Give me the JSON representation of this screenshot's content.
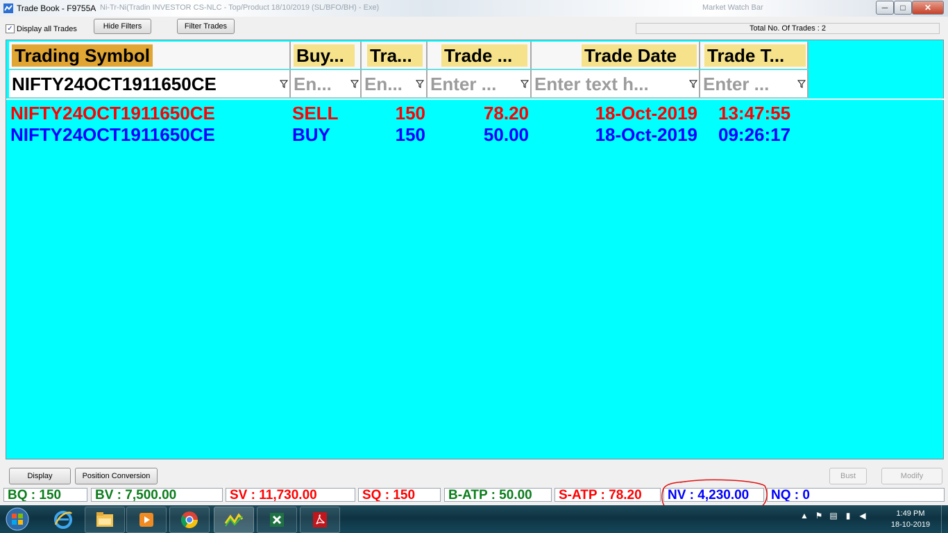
{
  "window": {
    "title": "Trade Book - F9755A",
    "background_title_text": "Ni-Tr-Ni(Tradin INVESTOR CS-NLC - Top/Product 18/10/2019 (SL/BFO/BH) - Exe)",
    "background_title_text2": "Market Watch Bar",
    "minimize_glyph": "─",
    "maximize_glyph": "□",
    "close_glyph": "✕"
  },
  "toolbar": {
    "display_all_label": "Display all Trades",
    "display_all_checked": true,
    "check_glyph": "✓",
    "hide_filters_label": "Hide Filters",
    "filter_trades_label": "Filter Trades",
    "total_trades_text": "Total No. Of Trades : 2"
  },
  "grid": {
    "columns": [
      {
        "header": "Trading Symbol",
        "filter": "NIFTY24OCT1911650CE",
        "filter_active": true,
        "sorted": true
      },
      {
        "header": "Buy...",
        "filter": "En...",
        "filter_active": false,
        "sorted": false
      },
      {
        "header": "Tra...",
        "filter": "En...",
        "filter_active": false,
        "sorted": false
      },
      {
        "header": "Trade ...",
        "filter": "Enter ...",
        "filter_active": false,
        "sorted": false
      },
      {
        "header": "Trade Date",
        "filter": "Enter text h...",
        "filter_active": false,
        "sorted": false
      },
      {
        "header": "Trade T...",
        "filter": "Enter ...",
        "filter_active": false,
        "sorted": false
      }
    ],
    "rows": [
      {
        "symbol": "NIFTY24OCT1911650CE",
        "side": "SELL",
        "qty": "150",
        "price": "78.20",
        "date": "18-Oct-2019",
        "time": "13:47:55",
        "color": "#ff0000"
      },
      {
        "symbol": "NIFTY24OCT1911650CE",
        "side": "BUY",
        "qty": "150",
        "price": "50.00",
        "date": "18-Oct-2019",
        "time": "09:26:17",
        "color": "#0000ff"
      }
    ],
    "background_color": "#00ffff"
  },
  "actions": {
    "display_label": "Display",
    "position_conversion_label": "Position Conversion",
    "bust_label": "Bust",
    "modify_label": "Modify"
  },
  "stats": {
    "bq": "BQ : 150",
    "bv": "BV : 7,500.00",
    "sv": "SV : 11,730.00",
    "sq": "SQ : 150",
    "batp": "B-ATP : 50.00",
    "satp": "S-ATP : 78.20",
    "nv": "NV : 4,230.00",
    "nq": "NQ : 0"
  },
  "taskbar": {
    "apps": [
      "ie-icon",
      "explorer-icon",
      "media-player-icon",
      "chrome-icon",
      "trading-app-icon",
      "excel-icon",
      "pdf-icon"
    ],
    "clock_time": "1:49 PM",
    "clock_date": "18-10-2019"
  },
  "colors": {
    "sell": "#ff0000",
    "buy": "#0000ff",
    "stat_green": "#0b7d1b",
    "header_label": "#f5e28a",
    "header_sorted": "#e0a533"
  }
}
